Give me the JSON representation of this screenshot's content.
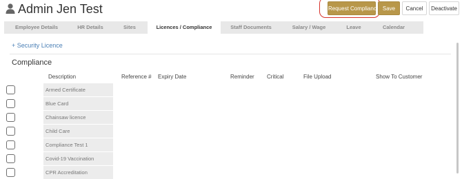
{
  "header": {
    "title": "Admin Jen Test",
    "icon": "user-icon"
  },
  "actions": {
    "request_compliance": "Request Compliance",
    "save": "Save",
    "cancel": "Cancel",
    "deactivate": "Deactivate"
  },
  "tabs": [
    {
      "label": "Employee Details"
    },
    {
      "label": "HR Details"
    },
    {
      "label": "Sites"
    },
    {
      "label": "Licences / Compliance",
      "active": true
    },
    {
      "label": "Staff Documents"
    },
    {
      "label": "Salary / Wage"
    },
    {
      "label": "Leave"
    },
    {
      "label": "Calendar"
    }
  ],
  "licences": {
    "add_link": "+ Security Licence"
  },
  "compliance": {
    "title": "Compliance",
    "columns": {
      "description": "Description",
      "reference": "Reference #",
      "expiry": "Expiry Date",
      "reminder": "Reminder",
      "critical": "Critical",
      "file_upload": "File Upload",
      "show_to_customer": "Show To Customer"
    },
    "items": [
      "Armed Certificate",
      "Blue Card",
      "Chainsaw licence",
      "Child Care",
      "Compliance Test 1",
      "Covid-19 Vaccination",
      "CPR Accreditation"
    ]
  },
  "colors": {
    "accent": "#b8974a",
    "link": "#4a7fb5",
    "highlight": "#d7322b",
    "tab_bar": "#e8e8e8"
  }
}
